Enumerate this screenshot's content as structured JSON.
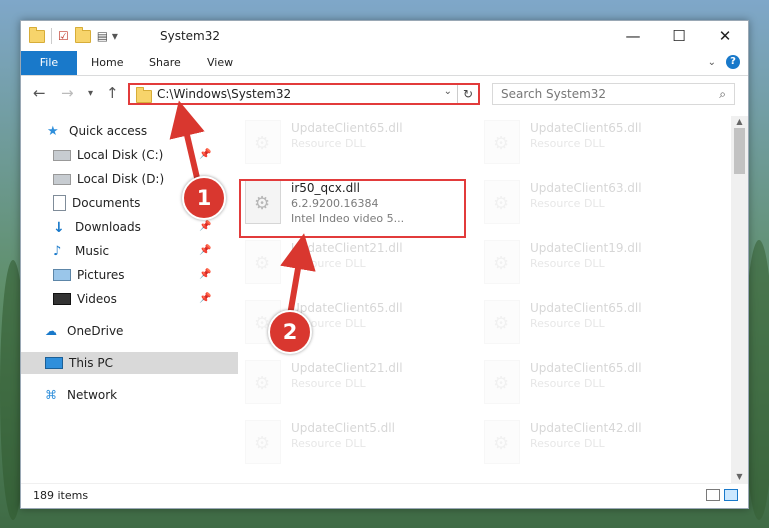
{
  "window": {
    "title": "System32",
    "controls": {
      "minimize": "—",
      "maximize": "☐",
      "close": "✕"
    }
  },
  "ribbon": {
    "tabs": [
      "File",
      "Home",
      "Share",
      "View"
    ]
  },
  "navigation": {
    "address": "C:\\Windows\\System32",
    "search_placeholder": "Search System32"
  },
  "sidebar": {
    "items": [
      {
        "label": "Quick access",
        "icon": "star-icon",
        "pinned": false
      },
      {
        "label": "Local Disk (C:)",
        "icon": "drive-icon",
        "pinned": true
      },
      {
        "label": "Local Disk (D:)",
        "icon": "drive-icon",
        "pinned": false
      },
      {
        "label": "Documents",
        "icon": "documents-icon",
        "pinned": true
      },
      {
        "label": "Downloads",
        "icon": "download-icon",
        "pinned": true
      },
      {
        "label": "Music",
        "icon": "music-icon",
        "pinned": true
      },
      {
        "label": "Pictures",
        "icon": "pictures-icon",
        "pinned": true
      },
      {
        "label": "Videos",
        "icon": "videos-icon",
        "pinned": true
      },
      {
        "label": "OneDrive",
        "icon": "cloud-icon",
        "pinned": false
      },
      {
        "label": "This PC",
        "icon": "computer-icon",
        "pinned": false,
        "selected": true
      },
      {
        "label": "Network",
        "icon": "network-icon",
        "pinned": false
      }
    ]
  },
  "files": {
    "left": [
      {
        "name": "UpdateClient65.dll",
        "type": "Resource DLL"
      },
      {
        "name": "ir50_qcx.dll",
        "version": "6.2.9200.16384",
        "description": "Intel Indeo video 5..."
      },
      {
        "name": "UpdateClient21.dll",
        "type": "Resource DLL"
      },
      {
        "name": "UpdateClient65.dll",
        "type": "Resource DLL"
      },
      {
        "name": "UpdateClient21.dll",
        "type": "Resource DLL"
      },
      {
        "name": "UpdateClient5.dll",
        "type": "Resource DLL"
      }
    ],
    "right": [
      {
        "name": "UpdateClient65.dll",
        "type": "Resource DLL"
      },
      {
        "name": "UpdateClient63.dll",
        "type": "Resource DLL"
      },
      {
        "name": "UpdateClient19.dll",
        "type": "Resource DLL"
      },
      {
        "name": "UpdateClient65.dll",
        "type": "Resource DLL"
      },
      {
        "name": "UpdateClient65.dll",
        "type": "Resource DLL"
      },
      {
        "name": "UpdateClient42.dll",
        "type": "Resource DLL"
      }
    ]
  },
  "status": {
    "count": "189 items"
  },
  "callouts": [
    "1",
    "2"
  ],
  "accent": "#e23b3b"
}
